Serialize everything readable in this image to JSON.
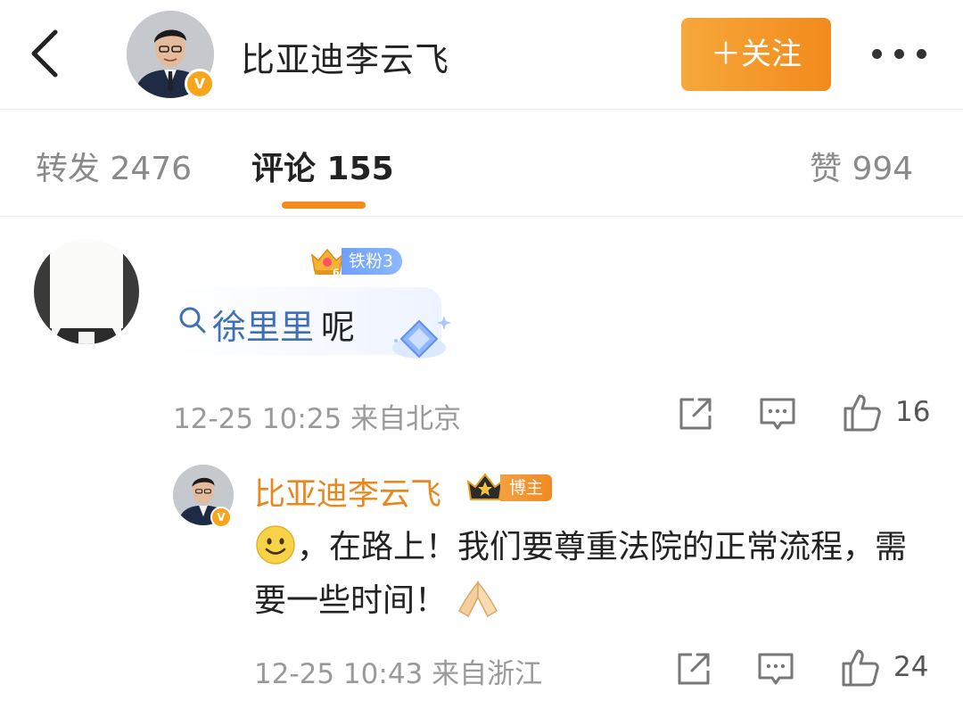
{
  "header": {
    "title": "比亚迪李云飞",
    "verified_mark": "V",
    "follow_label": "＋关注"
  },
  "tabs": {
    "repost": "转发 2476",
    "comments": "评论 155",
    "likes": "赞 994"
  },
  "comment": {
    "fan_badge": {
      "level": "6",
      "label": "铁粉3"
    },
    "topic": "徐里里",
    "text_suffix": "呢",
    "timestamp": "12-25 10:25",
    "location": "来自北京",
    "likes": "16",
    "reply": {
      "author": "比亚迪李云飞",
      "verified_mark": "V",
      "badge_label": "博主",
      "text_part1": "，在路上！我们要尊重法院的正常流程，需要一些时间！",
      "timestamp": "12-25 10:43",
      "location": "来自浙江",
      "likes": "24"
    }
  },
  "icons": {
    "back": "chevron-left-icon",
    "more": "more-dots-icon",
    "search": "search-icon",
    "share": "share-icon",
    "comment": "comment-icon",
    "like": "thumbs-up-icon",
    "smile": "smile-emoji-icon",
    "pray": "pray-hands-emoji-icon"
  },
  "colors": {
    "accent_orange": "#f28a1c",
    "topic_blue": "#3f6fb6",
    "fan_blue": "#7aaaff",
    "verified_gold": "#f7a51c"
  }
}
